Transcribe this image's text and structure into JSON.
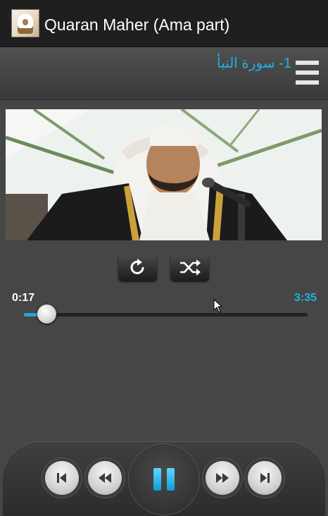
{
  "app": {
    "title": "Quaran Maher (Ama part)"
  },
  "header": {
    "surah_title": "1- سورة النبأ"
  },
  "banner": {
    "icon": "reciter-photo"
  },
  "controls": {
    "repeat_icon": "repeat-icon",
    "shuffle_icon": "shuffle-icon"
  },
  "player": {
    "current_time": "0:17",
    "total_time": "3:35",
    "progress": 0.079
  },
  "transport": {
    "prev_icon": "skip-previous-icon",
    "rewind_icon": "rewind-icon",
    "pause_icon": "pause-icon",
    "ff_icon": "fast-forward-icon",
    "next_icon": "skip-next-icon"
  },
  "colors": {
    "accent": "#1fb0e6",
    "background": "#464646",
    "actionbar": "#1f1f1f"
  }
}
